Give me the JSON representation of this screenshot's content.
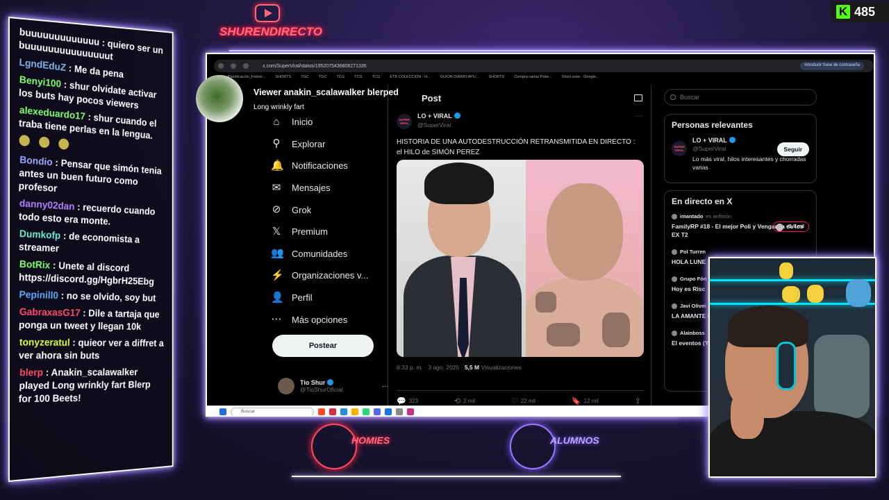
{
  "kick": {
    "count": "485",
    "logo": "K"
  },
  "brand": {
    "name": "SHURENDIRECTO",
    "icon": "youtube-icon"
  },
  "chat": [
    {
      "user": "",
      "text": "buuuuuuuuuuuuu : quiero ser un buuuuuuuuuuuuuuut",
      "color": "#ffffff"
    },
    {
      "user": "LgndEduZ",
      "text": " : Me da pena",
      "color": "#7fb2e8"
    },
    {
      "user": "Benyi100",
      "text": " : shur olvidate activar los buts hay pocos viewers",
      "color": "#7cff6b"
    },
    {
      "user": "alexeduardo17",
      "text": " : shur cuando el traba tiene perlas en la lengua.",
      "color": "#7cff6b"
    },
    {
      "user": "Bondio",
      "text": " : Pensar que simón tenia antes un buen futuro como profesor",
      "color": "#9aa6ff"
    },
    {
      "user": "danny02dan",
      "text": " : recuerdo cuando todo esto era monte.",
      "color": "#b77cff"
    },
    {
      "user": "Dumkofp",
      "text": " : de economista a streamer",
      "color": "#6be8d6"
    },
    {
      "user": "BotRix",
      "text": " : Unete al discord https://discord.gg/HgbrH25Ebg",
      "color": "#7cff6b"
    },
    {
      "user": "Pepinill0",
      "text": " : no se olvido, soy but",
      "color": "#5aa9ff"
    },
    {
      "user": "GabraxasG17",
      "text": " : Dile a tartaja que ponga un tweet y llegan 10k",
      "color": "#ff4b6b"
    },
    {
      "user": "tonyzeratul",
      "text": " : quieor ver a diffret a ver ahora sin buts",
      "color": "#d8ff3a"
    },
    {
      "user": "blerp",
      "text": " : Anakin_scalawalker played Long wrinkly fart Blerp for 100 Beets!",
      "color": "#ff4b6b"
    }
  ],
  "browser": {
    "url": "x.com/SuperViral/status/1952075436806271335",
    "passphrase_btn": "Introducir frase de contraseña",
    "bookmarks": [
      "Planificación_Febrer...",
      "SHORTS",
      "TGC",
      "TGC",
      "TCG",
      "TCG",
      "TCG",
      "ETB COLECCION - H...",
      "GUION DIARIO APU...",
      "SHORTS",
      "Compra cartas Poke...",
      "ShurLocke - Google..."
    ]
  },
  "viewer": {
    "title": "Viewer anakin_scalawalker blerped",
    "subtitle": "Long wrinkly fart"
  },
  "x_nav": [
    {
      "label": "Inicio",
      "icon": "home-icon",
      "glyph": "⌂"
    },
    {
      "label": "Explorar",
      "icon": "search-icon",
      "glyph": "⚲"
    },
    {
      "label": "Notificaciones",
      "icon": "bell-icon",
      "glyph": "🔔"
    },
    {
      "label": "Mensajes",
      "icon": "mail-icon",
      "glyph": "✉"
    },
    {
      "label": "Grok",
      "icon": "grok-icon",
      "glyph": "⊘"
    },
    {
      "label": "Premium",
      "icon": "x-logo-icon",
      "glyph": "𝕏"
    },
    {
      "label": "Comunidades",
      "icon": "people-icon",
      "glyph": "👥"
    },
    {
      "label": "Organizaciones v...",
      "icon": "bolt-icon",
      "glyph": "⚡"
    },
    {
      "label": "Perfil",
      "icon": "person-icon",
      "glyph": "👤"
    },
    {
      "label": "Más opciones",
      "icon": "more-circle-icon",
      "glyph": "⋯"
    }
  ],
  "post_button": "Postear",
  "profile": {
    "name": "Tio Shur",
    "handle": "@TioShurOficial",
    "more": "···"
  },
  "post": {
    "header": "Post",
    "account_name": "LO + VIRAL",
    "account_handle": "@SuperViral",
    "avatar_text": "SUPER VIRAL",
    "more": "···",
    "text": "HISTORIA DE UNA AUTODESTRUCCIÓN RETRANSMITIDA EN DIRECTO : el HILO de SIMÓN PEREZ",
    "time": "8:33 p. m. · 3 ago. 2025 · ",
    "views_count": "5,5 M",
    "views_label": " Visualizaciones",
    "actions": [
      {
        "icon": "reply-icon",
        "glyph": "💬",
        "count": "323"
      },
      {
        "icon": "retweet-icon",
        "glyph": "⟲",
        "count": "2 mil"
      },
      {
        "icon": "like-icon",
        "glyph": "♡",
        "count": "22 mil"
      },
      {
        "icon": "bookmark-icon",
        "glyph": "🔖",
        "count": "12 mil"
      },
      {
        "icon": "share-icon",
        "glyph": "⇪",
        "count": ""
      }
    ]
  },
  "sidebar": {
    "search_placeholder": "Buscar",
    "relevant_title": "Personas relevantes",
    "relevant": {
      "name": "LO + VIRAL",
      "handle": "@SuperViral",
      "bio": "Lo más viral, hilos interesantes y chorradas varias",
      "follow": "Seguir"
    },
    "live_title": "En directo en X",
    "live": [
      {
        "host": "imantado",
        "tag": "es anfitrión",
        "title": "FamilyRP #18 - El mejor Poli y Venganza de los EX T2",
        "count": "+1,9 mil"
      },
      {
        "host": "Pol Turren",
        "tag": "",
        "title": "HOLA LUNE",
        "count": ""
      },
      {
        "host": "Grupo Fón",
        "tag": "",
        "title": "Hoy es Risc",
        "count": ""
      },
      {
        "host": "Javi Olivei",
        "tag": "",
        "title": "LA AMANTE MOHEDANO",
        "count": ""
      },
      {
        "host": "Alainboss",
        "tag": "",
        "title": "El eventos (Y NOS",
        "count": ""
      }
    ]
  },
  "taskbar": {
    "search": "Buscar"
  },
  "bottom": [
    {
      "label": "HOMIES",
      "color": "#ff4b5c"
    },
    {
      "label": "ALUMNOS",
      "color": "#9a7bff"
    }
  ]
}
